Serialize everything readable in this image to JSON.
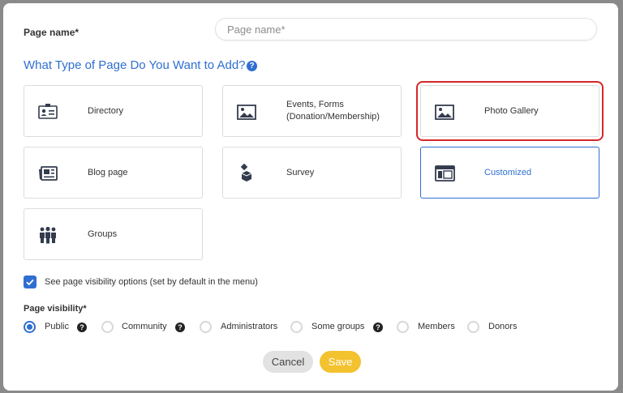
{
  "form": {
    "page_name_label": "Page name*",
    "page_name_placeholder": "Page name*",
    "page_name_value": "",
    "type_question": "What Type of Page Do You Want to Add?",
    "help_glyph": "?"
  },
  "page_types": [
    {
      "label": "Directory",
      "icon": "directory-card-icon"
    },
    {
      "label": "Events, Forms (Donation/Membership)",
      "icon": "image-icon"
    },
    {
      "label": "Photo Gallery",
      "icon": "image-icon",
      "highlighted": true
    },
    {
      "label": "Blog page",
      "icon": "newspaper-icon"
    },
    {
      "label": "Survey",
      "icon": "ballot-box-icon"
    },
    {
      "label": "Customized",
      "icon": "layout-window-icon",
      "selected": true
    },
    {
      "label": "Groups",
      "icon": "people-group-icon"
    }
  ],
  "visibility_options": {
    "checkbox_label": "See page visibility options (set by default in the menu)",
    "checked": true
  },
  "page_visibility": {
    "label": "Page visibility*",
    "selected": "Public",
    "options": [
      "Public",
      "Community",
      "Administrators",
      "Some groups",
      "Members",
      "Donors"
    ]
  },
  "actions": {
    "cancel_label": "Cancel",
    "save_label": "Save"
  },
  "colors": {
    "accent": "#2f6fd1",
    "save_button": "#f3c22f",
    "highlight_outline": "#d62828",
    "icon": "#333b4d"
  }
}
